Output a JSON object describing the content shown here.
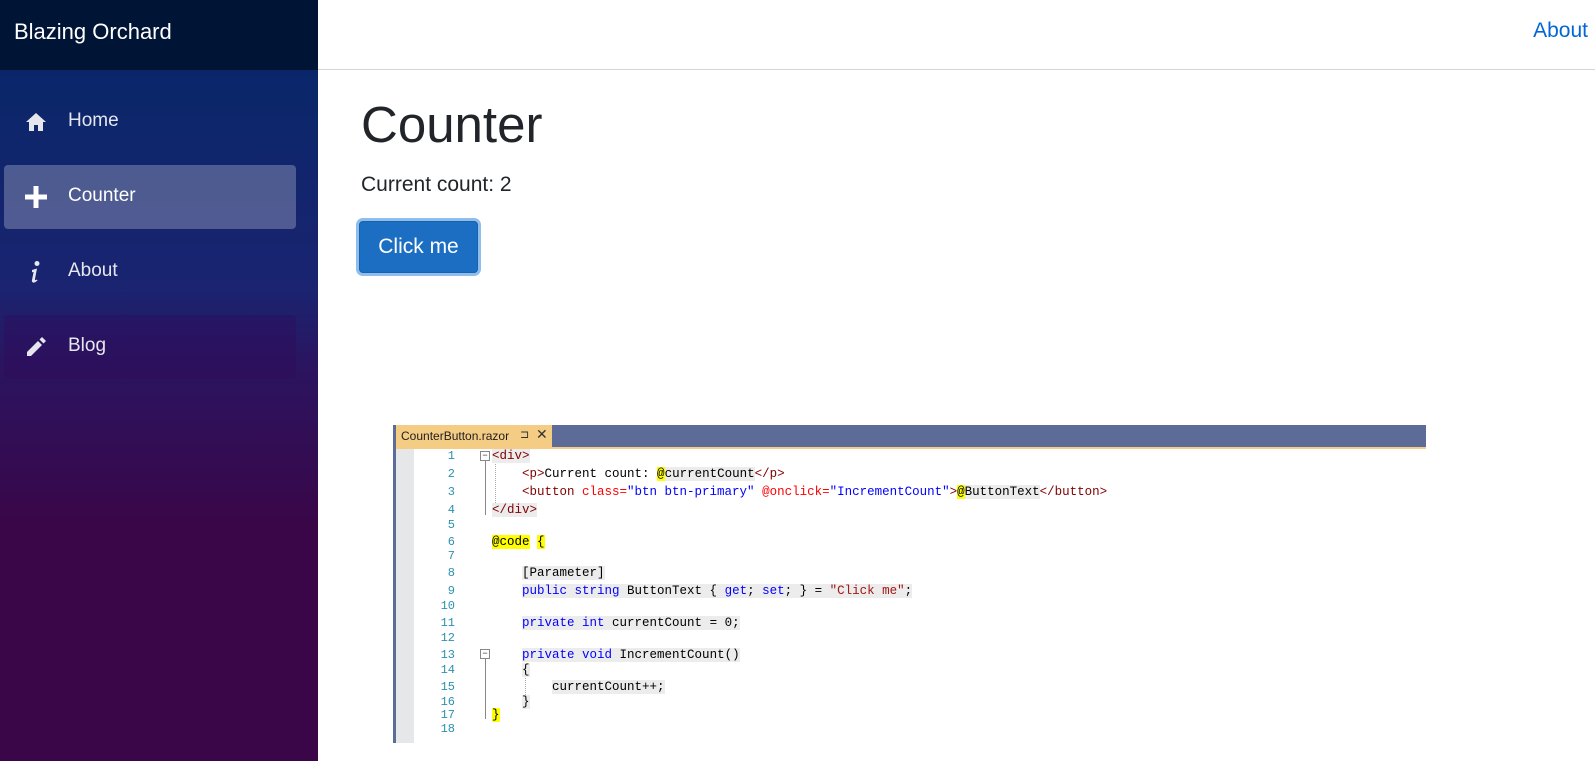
{
  "brand": "Blazing Orchard",
  "nav": [
    {
      "label": "Home",
      "icon": "home-icon"
    },
    {
      "label": "Counter",
      "icon": "plus-icon"
    },
    {
      "label": "About",
      "icon": "info-icon"
    },
    {
      "label": "Blog",
      "icon": "pencil-icon"
    }
  ],
  "top_about": "About",
  "main": {
    "title": "Counter",
    "count_text": "Current count: 2",
    "button_label": "Click me"
  },
  "code_editor": {
    "tab_name": "CounterButton.razor",
    "pin_glyph": "⊐",
    "close_glyph": "✕",
    "line_numbers": [
      "1",
      "2",
      "3",
      "4",
      "5",
      "6",
      "7",
      "8",
      "9",
      "10",
      "11",
      "12",
      "13",
      "14",
      "15",
      "16",
      "17",
      "18"
    ],
    "lines": {
      "l1_open": "<div>",
      "l2_p_open": "<p>",
      "l2_text": "Current count: ",
      "l2_at": "@",
      "l2_var": "currentCount",
      "l2_p_close": "</p>",
      "l3_btn_open": "<button ",
      "l3_class_attr": "class=",
      "l3_class_val": "\"btn btn-primary\"",
      "l3_onclick_attr": " @onclick=",
      "l3_onclick_val": "\"IncrementCount\"",
      "l3_gt": ">",
      "l3_at": "@",
      "l3_var": "ButtonText",
      "l3_btn_close": "</button>",
      "l4_close": "</div>",
      "l6_code": "@code",
      "l6_brace": "{",
      "l8": "[Parameter]",
      "l9_public": "public",
      "l9_string": "string",
      "l9_name": " ButtonText { ",
      "l9_get": "get",
      "l9_semi1": "; ",
      "l9_set": "set",
      "l9_rest": "; } = ",
      "l9_str": "\"Click me\"",
      "l9_end": ";",
      "l11_private": "private",
      "l11_int": "int",
      "l11_rest": " currentCount = 0;",
      "l13_private": "private",
      "l13_void": "void",
      "l13_rest": " IncrementCount()",
      "l14": "{",
      "l15": "currentCount++;",
      "l16": "}",
      "l17": "}"
    }
  }
}
